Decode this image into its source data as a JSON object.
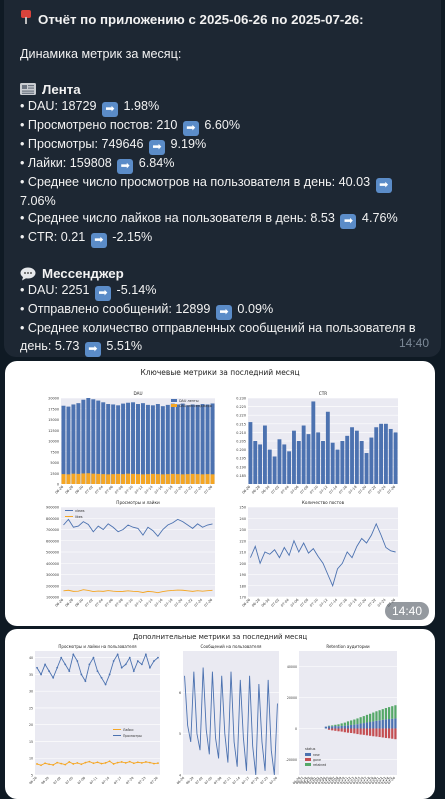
{
  "message": {
    "header_icon": "red-pin-icon",
    "title": "Отчёт по приложению с 2025-06-26 по 2025-07-26:",
    "subtitle": "Динамика метрик за месяц:",
    "feed": {
      "icon": "newspaper-icon",
      "title": "Лента",
      "lines": [
        {
          "text": "• DAU: 18729",
          "change": "1.98%"
        },
        {
          "text": "• Просмотрено постов: 210",
          "change": "6.60%"
        },
        {
          "text": "• Просмотры: 749646",
          "change": "9.19%"
        },
        {
          "text": "• Лайки: 159808",
          "change": "6.84%"
        },
        {
          "text": "• Среднее число просмотров на пользователя в день: 40.03",
          "change": "7.06%"
        },
        {
          "text": "• Среднее число лайков на пользователя в день: 8.53",
          "change": "4.76%"
        },
        {
          "text": "• CTR: 0.21",
          "change": "-2.15%"
        }
      ]
    },
    "messenger": {
      "icon": "speech-bubble-icon",
      "title": "Мессенджер",
      "lines": [
        {
          "text": "• DAU: 2251",
          "change": "-5.14%"
        },
        {
          "text": "• Отправлено сообщений: 12899",
          "change": "0.09%"
        },
        {
          "text": "• Среднее количество отправленных сообщений на пользователя в день: 5.73",
          "change": "5.51%"
        }
      ]
    },
    "arrow_icon": "right-arrow-icon",
    "arrow_glyph": "➡",
    "time": "14:40"
  },
  "image1": {
    "title": "Ключевые метрики за последний месяц",
    "time": "14:40",
    "colors": {
      "blue": "#4c72b0",
      "orange": "#f5a623",
      "bg": "#eaeaf2"
    }
  },
  "image2": {
    "title": "Дополнительные метрики за последний месяц"
  },
  "chart_data": [
    {
      "type": "bar",
      "title": "DAU",
      "categories": [
        "06-26",
        "06-27",
        "06-28",
        "06-29",
        "06-30",
        "07-01",
        "07-02",
        "07-03",
        "07-04",
        "07-05",
        "07-06",
        "07-07",
        "07-08",
        "07-09",
        "07-10",
        "07-11",
        "07-12",
        "07-13",
        "07-14",
        "07-15",
        "07-16",
        "07-17",
        "07-18",
        "07-19",
        "07-20",
        "07-21",
        "07-22",
        "07-23",
        "07-24",
        "07-25",
        "07-26"
      ],
      "series": [
        {
          "name": "DAU ленты",
          "values": [
            18200,
            18000,
            18500,
            18800,
            19600,
            20000,
            19700,
            19400,
            19000,
            18600,
            18500,
            18300,
            18700,
            18900,
            19000,
            18600,
            18800,
            18400,
            18300,
            18600,
            18100,
            18400,
            18700,
            18500,
            18700,
            18300,
            18500,
            18400,
            18600,
            18500,
            18729
          ]
        },
        {
          "name": "DAU мессенджера",
          "values": [
            2300,
            2250,
            2400,
            2350,
            2450,
            2500,
            2400,
            2350,
            2300,
            2250,
            2300,
            2350,
            2300,
            2400,
            2350,
            2300,
            2250,
            2300,
            2350,
            2300,
            2250,
            2300,
            2350,
            2300,
            2250,
            2300,
            2350,
            2300,
            2250,
            2300,
            2251
          ]
        }
      ],
      "ylim": [
        0,
        20000
      ],
      "yticks": [
        0,
        2500,
        5000,
        7500,
        10000,
        12500,
        15000,
        17500,
        20000
      ]
    },
    {
      "type": "bar",
      "title": "CTR",
      "categories": [
        "06-26",
        "06-27",
        "06-28",
        "06-29",
        "06-30",
        "07-01",
        "07-02",
        "07-03",
        "07-04",
        "07-05",
        "07-06",
        "07-07",
        "07-08",
        "07-09",
        "07-10",
        "07-11",
        "07-12",
        "07-13",
        "07-14",
        "07-15",
        "07-16",
        "07-17",
        "07-18",
        "07-19",
        "07-20",
        "07-21",
        "07-22",
        "07-23",
        "07-24",
        "07-25",
        "07-26"
      ],
      "values": [
        0.216,
        0.205,
        0.203,
        0.214,
        0.2,
        0.196,
        0.206,
        0.203,
        0.199,
        0.211,
        0.205,
        0.214,
        0.209,
        0.228,
        0.21,
        0.205,
        0.222,
        0.204,
        0.2,
        0.205,
        0.208,
        0.213,
        0.211,
        0.205,
        0.198,
        0.207,
        0.213,
        0.215,
        0.215,
        0.212,
        0.21
      ],
      "ylim": [
        0.18,
        0.23
      ],
      "yticks": [
        0.185,
        0.19,
        0.195,
        0.2,
        0.205,
        0.21,
        0.215,
        0.22,
        0.225,
        0.23
      ]
    },
    {
      "type": "line",
      "title": "Просмотры и лайки",
      "x": [
        "06-26",
        "06-27",
        "06-28",
        "06-29",
        "06-30",
        "07-01",
        "07-02",
        "07-03",
        "07-04",
        "07-05",
        "07-06",
        "07-07",
        "07-08",
        "07-09",
        "07-10",
        "07-11",
        "07-12",
        "07-13",
        "07-14",
        "07-15",
        "07-16",
        "07-17",
        "07-18",
        "07-19",
        "07-20",
        "07-21",
        "07-22",
        "07-23",
        "07-24",
        "07-25",
        "07-26"
      ],
      "series": [
        {
          "name": "views",
          "values": [
            740000,
            790000,
            720000,
            730000,
            770000,
            745000,
            680000,
            730000,
            700000,
            750000,
            720000,
            680000,
            700000,
            740000,
            720000,
            710000,
            650000,
            720000,
            690000,
            640000,
            700000,
            740000,
            760000,
            790000,
            770000,
            740000,
            710000,
            750000,
            720000,
            740000,
            749646
          ]
        },
        {
          "name": "likes",
          "values": [
            155000,
            160000,
            150000,
            152000,
            165000,
            158000,
            148000,
            153000,
            150000,
            157000,
            152000,
            148000,
            150000,
            155000,
            151000,
            148000,
            140000,
            150000,
            146000,
            138000,
            148000,
            155000,
            158000,
            162000,
            160000,
            155000,
            150000,
            156000,
            152000,
            156000,
            159808
          ]
        }
      ],
      "ylim": [
        100000,
        900000
      ],
      "yticks": [
        100000,
        200000,
        300000,
        400000,
        500000,
        600000,
        700000,
        800000,
        900000
      ]
    },
    {
      "type": "line",
      "title": "Количество постов",
      "x": [
        "06-26",
        "06-27",
        "06-28",
        "06-29",
        "06-30",
        "07-01",
        "07-02",
        "07-03",
        "07-04",
        "07-05",
        "07-06",
        "07-07",
        "07-08",
        "07-09",
        "07-10",
        "07-11",
        "07-12",
        "07-13",
        "07-14",
        "07-15",
        "07-16",
        "07-17",
        "07-18",
        "07-19",
        "07-20",
        "07-21",
        "07-22",
        "07-23",
        "07-24",
        "07-25",
        "07-26"
      ],
      "series": [
        {
          "name": "posts",
          "values": [
            205,
            215,
            200,
            210,
            208,
            212,
            205,
            214,
            207,
            220,
            210,
            218,
            209,
            213,
            206,
            200,
            190,
            180,
            195,
            200,
            210,
            205,
            215,
            222,
            218,
            225,
            235,
            225,
            214,
            211,
            210
          ]
        }
      ],
      "ylim": [
        170,
        250
      ],
      "yticks": [
        170,
        180,
        190,
        200,
        210,
        220,
        230,
        240,
        250
      ]
    },
    {
      "type": "line",
      "title": "Просмотры и лайки на пользователя",
      "x": [
        "06-26",
        "06-27",
        "06-28",
        "06-29",
        "06-30",
        "07-01",
        "07-02",
        "07-03",
        "07-04",
        "07-05",
        "07-06",
        "07-07",
        "07-08",
        "07-09",
        "07-10",
        "07-11",
        "07-12",
        "07-13",
        "07-14",
        "07-15",
        "07-16",
        "07-17",
        "07-18",
        "07-19",
        "07-20",
        "07-21",
        "07-22",
        "07-23",
        "07-24",
        "07-25",
        "07-26"
      ],
      "series": [
        {
          "name": "Лайки",
          "values": [
            8.3,
            7.9,
            8.5,
            8.2,
            8.0,
            8.7,
            8.4,
            8.1,
            8.9,
            8.3,
            8.6,
            8.2,
            8.7,
            9.0,
            8.5,
            8.8,
            8.4,
            8.6,
            9.1,
            8.3,
            8.7,
            8.9,
            8.6,
            9.0,
            8.5,
            8.8,
            8.6,
            8.9,
            8.7,
            8.4,
            8.53
          ]
        },
        {
          "name": "Просмотры",
          "values": [
            37,
            35,
            38,
            36,
            34,
            37,
            40,
            38,
            36,
            41,
            39,
            35,
            33,
            38,
            40,
            36,
            34,
            32,
            35,
            39,
            41,
            37,
            38,
            40,
            36,
            39,
            38,
            41,
            37,
            39,
            40.03
          ]
        }
      ],
      "ylim": [
        5,
        42
      ],
      "yticks": [
        5,
        10,
        15,
        20,
        25,
        30,
        35,
        40
      ]
    },
    {
      "type": "line",
      "title": "Сообщений на пользователя",
      "x": [
        "06-26",
        "06-27",
        "06-28",
        "06-29",
        "06-30",
        "07-01",
        "07-02",
        "07-03",
        "07-04",
        "07-05",
        "07-06",
        "07-07",
        "07-08",
        "07-09",
        "07-10",
        "07-11",
        "07-12",
        "07-13",
        "07-14",
        "07-15",
        "07-16",
        "07-17",
        "07-18",
        "07-19",
        "07-20",
        "07-21",
        "07-22",
        "07-23",
        "07-24",
        "07-25",
        "07-26"
      ],
      "series": [
        {
          "name": "messages",
          "values": [
            6.4,
            5.2,
            4.8,
            6.5,
            5.0,
            4.6,
            6.6,
            5.1,
            4.5,
            6.5,
            4.9,
            4.4,
            6.4,
            5.0,
            4.3,
            6.5,
            4.8,
            4.2,
            6.3,
            4.9,
            4.1,
            6.4,
            4.7,
            4.0,
            6.2,
            4.8,
            4.1,
            6.3,
            4.6,
            4.0,
            5.73
          ]
        }
      ],
      "ylim": [
        4,
        7
      ],
      "yticks": [
        4,
        5,
        6
      ]
    },
    {
      "type": "bar",
      "title": "Retention аудитории",
      "categories": [
        "06-26",
        "06-27",
        "06-28",
        "06-29",
        "06-30",
        "07-01",
        "07-02",
        "07-03",
        "07-04",
        "07-05",
        "07-06",
        "07-07",
        "07-08",
        "07-09",
        "07-10",
        "07-11",
        "07-12",
        "07-13",
        "07-14",
        "07-15",
        "07-16",
        "07-17",
        "07-18",
        "07-19",
        "07-20",
        "07-21",
        "07-22",
        "07-23",
        "07-24",
        "07-25",
        "07-26"
      ],
      "legend_title": "status",
      "series": [
        {
          "name": "new",
          "values": [
            0,
            0,
            0,
            0,
            0,
            0,
            0,
            0,
            1200,
            1500,
            1400,
            1600,
            1500,
            1700,
            1800,
            2100,
            2300,
            2500,
            2800,
            3200,
            3500,
            3900,
            4200,
            4600,
            5000,
            5300,
            5600,
            5900,
            6100,
            6300,
            6500
          ]
        },
        {
          "name": "gone",
          "values": [
            0,
            0,
            0,
            0,
            0,
            0,
            0,
            0,
            0,
            -800,
            -1200,
            -1500,
            -1800,
            -2000,
            -2400,
            -2700,
            -2900,
            -3200,
            -3600,
            -3900,
            -4100,
            -4400,
            -4700,
            -5000,
            -5200,
            -5500,
            -5800,
            -6100,
            -6300,
            -6600,
            -6900
          ]
        },
        {
          "name": "retained",
          "values": [
            0,
            0,
            0,
            0,
            0,
            0,
            0,
            0,
            0,
            300,
            600,
            800,
            1200,
            1600,
            2000,
            2500,
            2900,
            3300,
            3700,
            4100,
            4500,
            4900,
            5300,
            5700,
            6100,
            6500,
            6900,
            7300,
            7700,
            8100,
            8500
          ]
        }
      ],
      "ylim": [
        -30000,
        50000
      ],
      "yticks": [
        -20000,
        0,
        20000,
        40000
      ]
    }
  ]
}
